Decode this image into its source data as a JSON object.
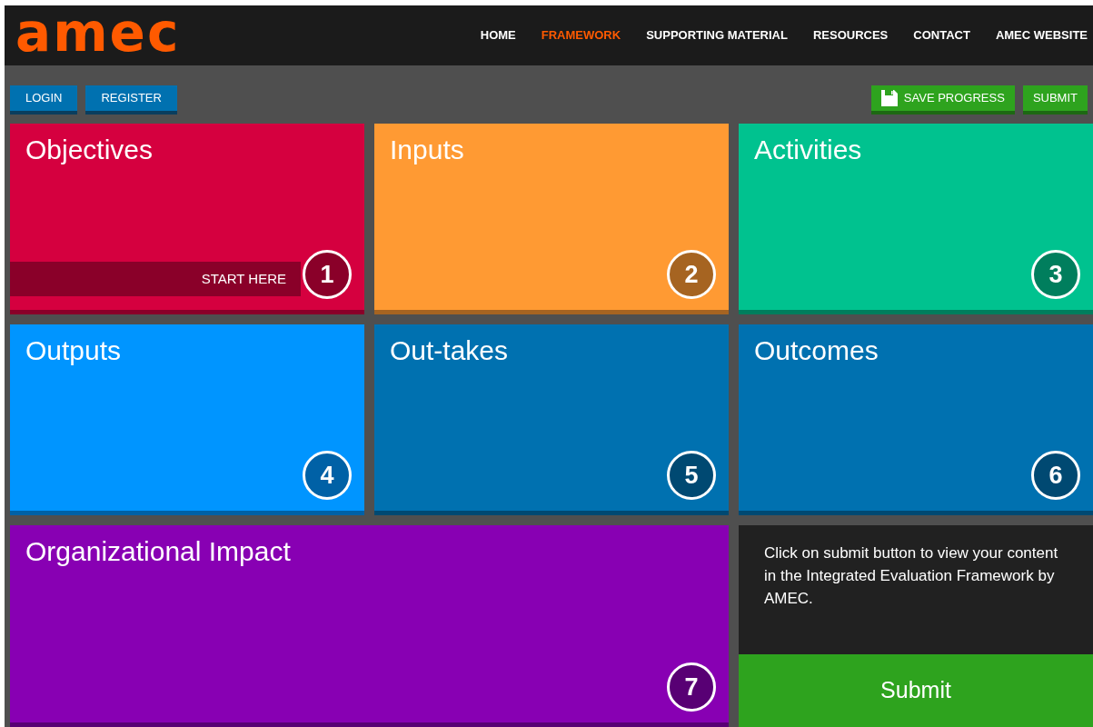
{
  "logo": "amec",
  "nav": [
    {
      "label": "HOME",
      "selected": false
    },
    {
      "label": "FRAMEWORK",
      "selected": true
    },
    {
      "label": "SUPPORTING MATERIAL",
      "selected": false
    },
    {
      "label": "RESOURCES",
      "selected": false
    },
    {
      "label": "CONTACT",
      "selected": false
    },
    {
      "label": "AMEC WEBSITE",
      "selected": false
    }
  ],
  "account_buttons": [
    "LOGIN",
    "REGISTER"
  ],
  "action_buttons": [
    {
      "label": "SAVE PROGRESS",
      "kind": "save"
    },
    {
      "label": "SUBMIT",
      "kind": "plain"
    }
  ],
  "tiles": [
    {
      "title": "Objectives",
      "number": "1",
      "color": "#d5003f",
      "kind": "normal",
      "banner": "START HERE"
    },
    {
      "title": "Inputs",
      "number": "2",
      "color": "#ff9a33",
      "kind": "normal"
    },
    {
      "title": "Activities",
      "number": "3",
      "color": "#00c28f",
      "kind": "normal"
    },
    {
      "title": "Outputs",
      "number": "4",
      "color": "#0095ff",
      "kind": "normal"
    },
    {
      "title": "Out-takes",
      "number": "5",
      "color": "#0071b0",
      "kind": "normal"
    },
    {
      "title": "Outcomes",
      "number": "6",
      "color": "#0071b0",
      "kind": "normal"
    },
    {
      "title": "Organizational Impact",
      "number": "7",
      "color": "#8800b3",
      "kind": "wide"
    }
  ],
  "submit_panel": {
    "text": "Click on submit button to view your content in the Integrated Evaluation Framework by AMEC.",
    "button": "Submit"
  }
}
